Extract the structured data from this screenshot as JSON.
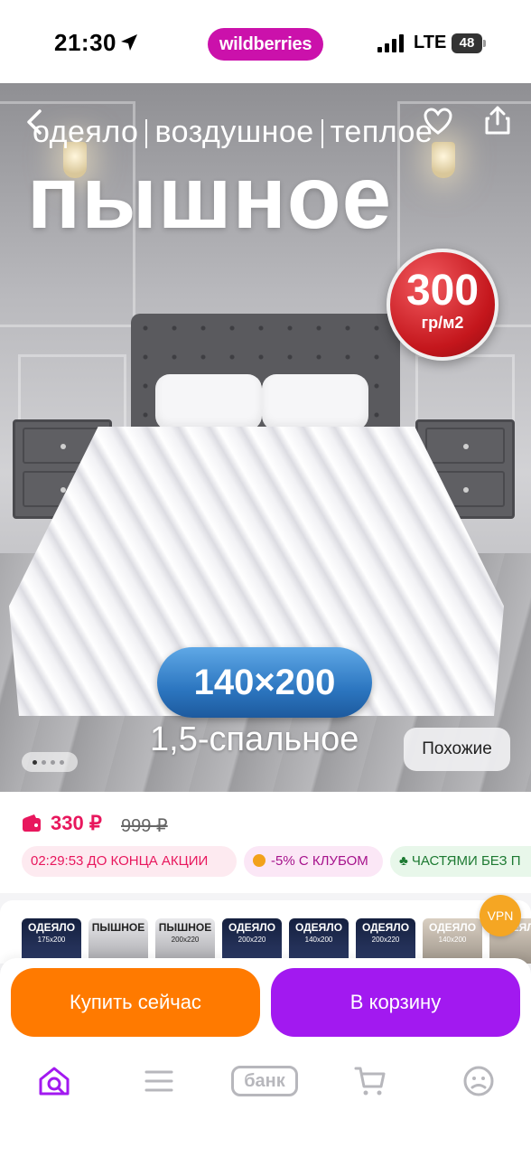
{
  "status_bar": {
    "time": "21:30",
    "brand": "wildberries",
    "network": "LTE",
    "battery": "48"
  },
  "hero": {
    "line1": [
      "одеяло",
      "воздушное",
      "теплое"
    ],
    "big_title": "пышное",
    "weight_value": "300",
    "weight_unit": "гр/м2",
    "size": "140×200",
    "bed_type": "1,5-спальное",
    "similar_label": "Похожие",
    "slide_count": 4,
    "slide_active": 1
  },
  "price": {
    "current": "330 ₽",
    "old": "999 ₽",
    "timer_text": "02:29:53  ДО КОНЦА АКЦИИ",
    "club_text": "-5% С КЛУБОМ",
    "installments_text": "ЧАСТЯМИ БЕЗ П"
  },
  "thumbnails": [
    {
      "big": "ОДЕЯЛО",
      "small": "175x200"
    },
    {
      "big": "ПЫШНОЕ",
      "small": ""
    },
    {
      "big": "ПЫШНОЕ",
      "small": "200x220"
    },
    {
      "big": "ОДЕЯЛО",
      "small": "200x220"
    },
    {
      "big": "ОДЕЯЛО",
      "small": "140x200"
    },
    {
      "big": "ОДЕЯЛО",
      "small": "200x220"
    },
    {
      "big": "ОДЕЯЛО",
      "small": "140x200"
    },
    {
      "big": "ОДЕЯЛО",
      "small": ""
    }
  ],
  "vpn_label": "VPN",
  "actions": {
    "buy_now": "Купить сейчас",
    "add_to_cart": "В корзину"
  },
  "tab_bar": {
    "bank_label": "банк",
    "items": [
      "home-search-icon",
      "menu-icon",
      "bank",
      "cart-icon",
      "profile-icon"
    ]
  },
  "colors": {
    "brand": "#cb11ab",
    "price": "#e8175d",
    "buy_now": "#ff7a00",
    "add_to_cart": "#a219f0",
    "size_pill": "#2c76c0",
    "weight_badge": "#c4161c"
  }
}
